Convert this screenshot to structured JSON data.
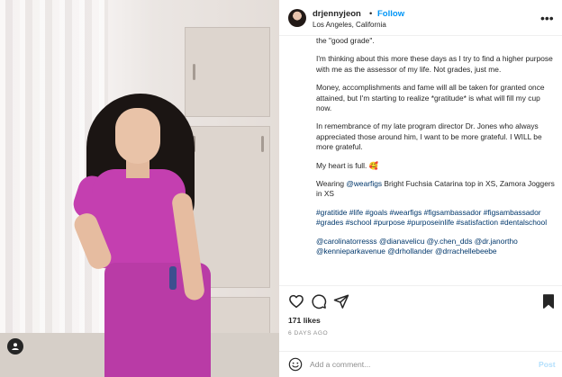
{
  "post": {
    "username": "drjennyjeon",
    "separator": "•",
    "follow_label": "Follow",
    "location": "Los Angeles, California",
    "more_label": "•••"
  },
  "caption": {
    "p0": "the \"good grade\".",
    "p1": "I'm thinking about this more these days as I try to find a higher purpose with me as the assessor of my life. Not grades, just me.",
    "p2": "Money, accomplishments and fame will all be taken for granted once attained, but I'm starting to realize *gratitude* is what will fill my cup now.",
    "p3": "In remembrance of my late program director Dr. Jones who always appreciated those around him, I want to be more grateful. I WILL be more grateful.",
    "p4": "My heart is full. 🥰",
    "p5_pre": "Wearing ",
    "p5_mention": "@wearfigs",
    "p5_post": " Bright Fuchsia Catarina top in XS, Zamora Joggers in XS",
    "hashtags": "#gratitide #life #goals #wearfigs #figsambassador #figsambassador #grades #school #purpose #purposeinlife #satisfaction #dentalschool",
    "mentions": "@carolinatorresss @dianavelicu @y.chen_dds @dr.janortho @kennieparkavenue @drhollander @drrachellebeebe"
  },
  "stats": {
    "likes": "171 likes",
    "time": "6 DAYS AGO"
  },
  "comment": {
    "placeholder": "Add a comment...",
    "post_label": "Post"
  },
  "colors": {
    "link": "#0095f6",
    "mention": "#00376b",
    "post_disabled": "#b2dffc",
    "scrubs": "#c43fb0"
  },
  "icons": [
    "user-tag-icon",
    "heart-icon",
    "comment-icon",
    "share-icon",
    "bookmark-icon",
    "emoji-icon"
  ]
}
